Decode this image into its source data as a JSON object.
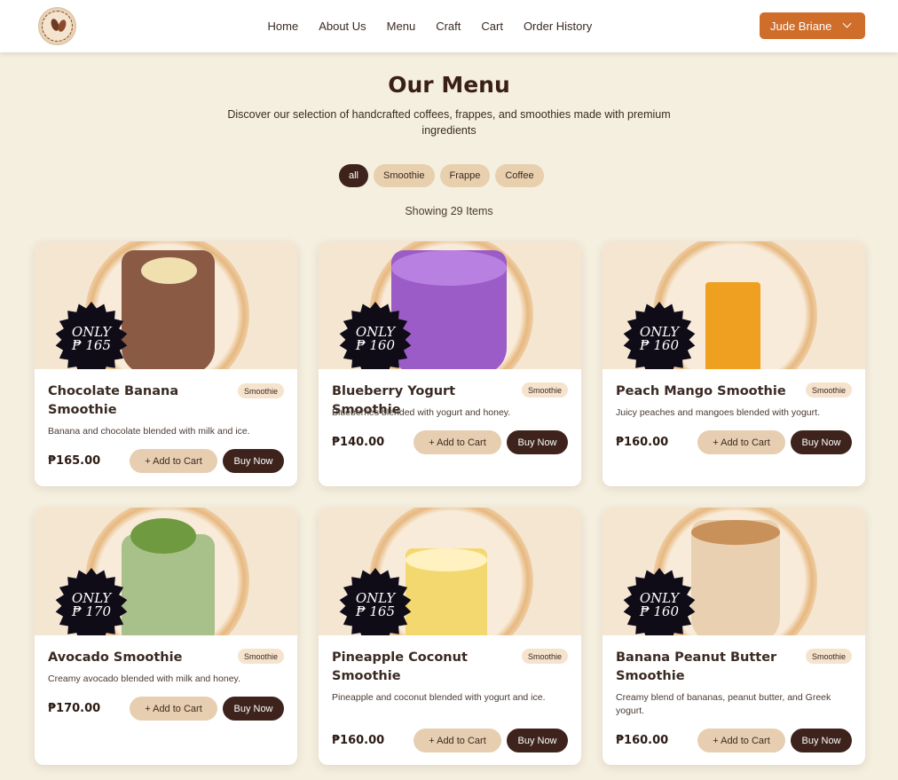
{
  "header": {
    "nav": [
      "Home",
      "About Us",
      "Menu",
      "Craft",
      "Cart",
      "Order History"
    ],
    "user_name": "Jude Briane"
  },
  "page": {
    "title": "Our Menu",
    "subtitle": "Discover our selection of handcrafted coffees, frappes, and smoothies made with premium ingredients",
    "filters": [
      "all",
      "Smoothie",
      "Frappe",
      "Coffee"
    ],
    "active_filter": "all",
    "count_text": "Showing 29 Items"
  },
  "buttons": {
    "add_to_cart": "+ Add to Cart",
    "buy_now": "Buy Now"
  },
  "badge_label": "ONLY",
  "products": [
    {
      "name": "Chocolate Banana Smoothie",
      "category": "Smoothie",
      "description": "Banana and chocolate blended with milk and ice.",
      "price": "₱165.00",
      "badge_price": "₱ 165",
      "drink_color": "#8a5a45"
    },
    {
      "name": "Blueberry Yogurt Smoothie",
      "category": "Smoothie",
      "description": "Blueberries blended with yogurt and honey.",
      "price": "₱140.00",
      "badge_price": "₱ 160",
      "drink_color": "#9b5cc8"
    },
    {
      "name": "Peach Mango Smoothie",
      "category": "Smoothie",
      "description": "Juicy peaches and mangoes blended with yogurt.",
      "price": "₱160.00",
      "badge_price": "₱ 160",
      "drink_color": "#f0a020"
    },
    {
      "name": "Avocado Smoothie",
      "category": "Smoothie",
      "description": "Creamy avocado blended with milk and honey.",
      "price": "₱170.00",
      "badge_price": "₱ 170",
      "drink_color": "#a8c08a"
    },
    {
      "name": "Pineapple Coconut Smoothie",
      "category": "Smoothie",
      "description": "Pineapple and coconut blended with yogurt and ice.",
      "price": "₱160.00",
      "badge_price": "₱ 165",
      "drink_color": "#f3d870"
    },
    {
      "name": "Banana Peanut Butter Smoothie",
      "category": "Smoothie",
      "description": "Creamy blend of bananas, peanut butter, and Greek yogurt.",
      "price": "₱160.00",
      "badge_price": "₱ 160",
      "drink_color": "#e8d0b0"
    }
  ],
  "colors": {
    "accent": "#cf6d2a",
    "dark": "#3d231c",
    "background": "#f5efdf",
    "chip": "#e8cfae"
  }
}
